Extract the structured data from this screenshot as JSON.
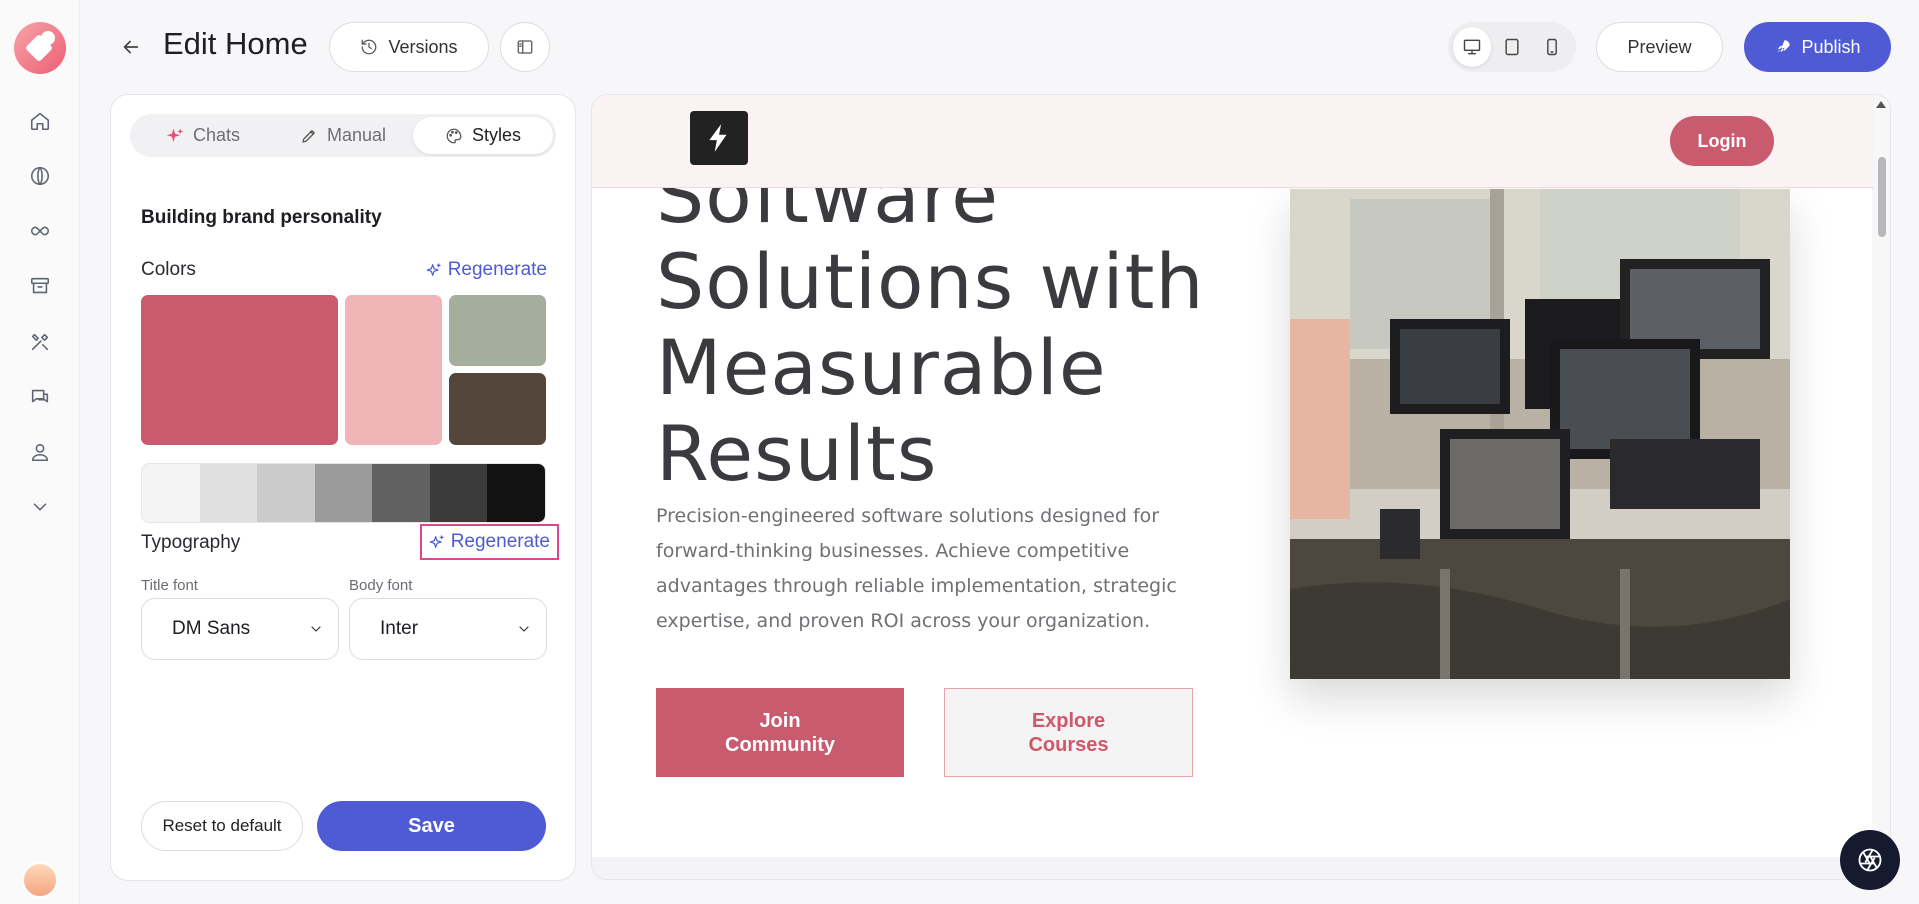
{
  "header": {
    "title": "Edit Home",
    "versions_label": "Versions",
    "preview_label": "Preview",
    "publish_label": "Publish"
  },
  "side_panel": {
    "tabs": [
      {
        "label": "Chats",
        "icon": "sparkle-icon"
      },
      {
        "label": "Manual",
        "icon": "pencil-icon"
      },
      {
        "label": "Styles",
        "icon": "palette-icon",
        "active": true
      }
    ],
    "section_title": "Building brand personality",
    "colors": {
      "label": "Colors",
      "regenerate_label": "Regenerate",
      "palette": [
        "#c95b6f",
        "#f0b6b7",
        "#a3ae9c",
        "#54463b"
      ],
      "grays": [
        "#f4f4f4",
        "#e0e0e0",
        "#cbcbcb",
        "#9b9b9b",
        "#616161",
        "#3b3b3b",
        "#121212"
      ]
    },
    "typography": {
      "label": "Typography",
      "regenerate_label": "Regenerate",
      "title_font_label": "Title font",
      "title_font_value": "DM Sans",
      "body_font_label": "Body font",
      "body_font_value": "Inter"
    },
    "reset_label": "Reset to default",
    "save_label": "Save"
  },
  "site_preview": {
    "login_label": "Login",
    "hero_title": "Software Solutions with Measurable Results",
    "hero_description": "Precision-engineered software solutions designed for forward-thinking businesses. Achieve competitive advantages through reliable implementation, strategic expertise, and proven ROI across your organization.",
    "primary_cta": "Join Community",
    "secondary_cta": "Explore Courses"
  },
  "colors": {
    "accent": "#4f5bd5",
    "brand": "#c95b6f"
  }
}
